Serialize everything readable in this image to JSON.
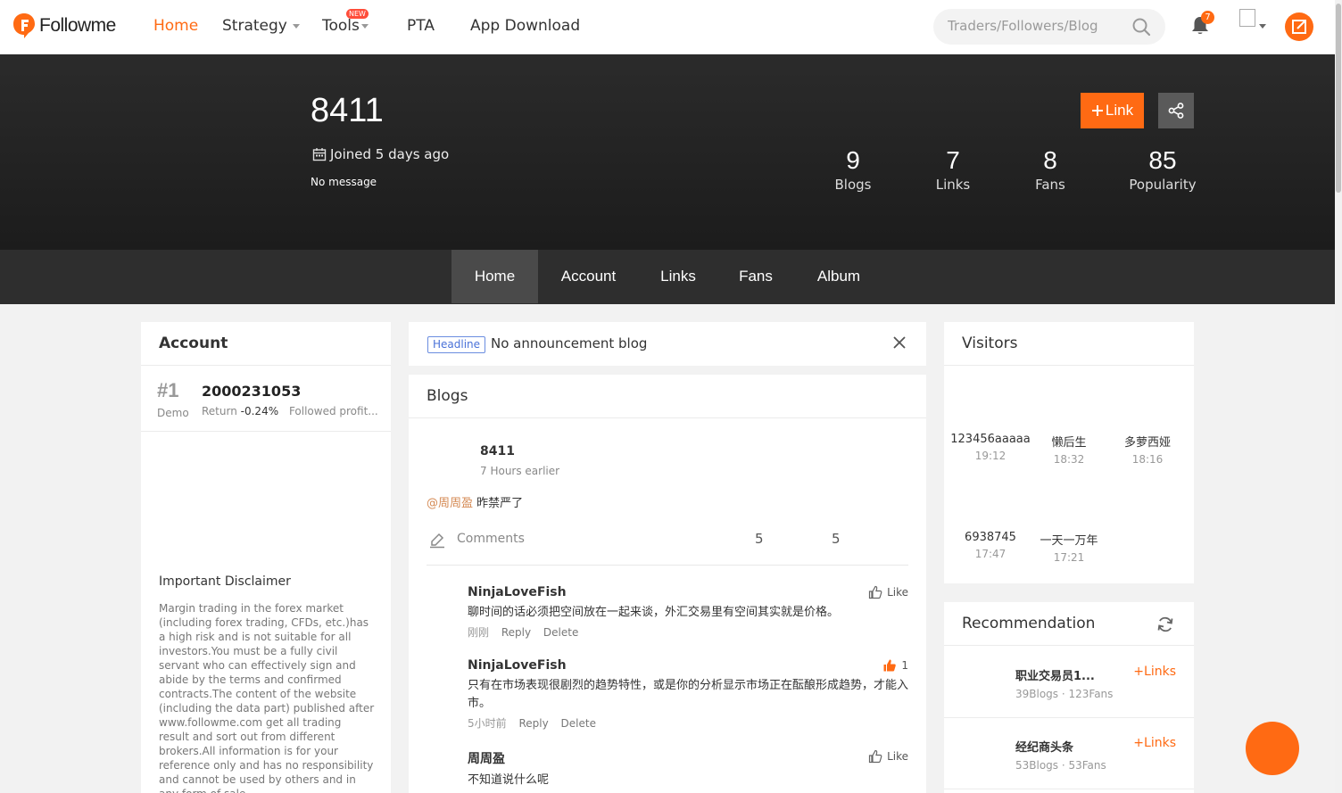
{
  "brand": {
    "name": "Followme",
    "accent": "#ff6a13"
  },
  "nav": {
    "home": "Home",
    "strategy": "Strategy",
    "tools": "Tools",
    "tools_badge": "NEW",
    "pta": "PTA",
    "app": "App Download"
  },
  "search": {
    "placeholder": "Traders/Followers/Blog"
  },
  "notifications": {
    "count": "7"
  },
  "profile": {
    "username": "8411",
    "joined": "Joined 5 days ago",
    "message": "No message",
    "link_button": "Link",
    "stats": [
      {
        "value": "9",
        "label": "Blogs"
      },
      {
        "value": "7",
        "label": "Links"
      },
      {
        "value": "8",
        "label": "Fans"
      },
      {
        "value": "85",
        "label": "Popularity"
      }
    ]
  },
  "tabs": [
    "Home",
    "Account",
    "Links",
    "Fans",
    "Album"
  ],
  "account": {
    "title": "Account",
    "rank": "#1",
    "type": "Demo",
    "number": "2000231053",
    "return_label": "Return",
    "return_value": "-0.24%",
    "followed": "Followed profit...",
    "disclaimer_title": "Important Disclaimer",
    "disclaimer_text": "Margin trading in the forex market (including forex trading, CFDs, etc.)has a high risk and is not suitable for all investors.You must be a fully civil servant who can effectively sign and abide by the terms and confirmed contracts.The content of the website (including the data part) published after www.followme.com get all trading result and sort out from different brokers.All information is for your reference only and has no responsibility and cannot be used by others and in any form of sale."
  },
  "headline": {
    "tag": "Headline",
    "text": "No announcement blog"
  },
  "blogs": {
    "title": "Blogs",
    "post": {
      "author": "8411",
      "time": "7 Hours earlier",
      "mention": "@周周盈",
      "body": " 昨禁严了",
      "comments_label": "Comments",
      "count_a": "5",
      "count_b": "5"
    },
    "comments": [
      {
        "name": "NinjaLoveFish",
        "text": "聊时间的话必须把空间放在一起来谈，外汇交易里有空间其实就是价格。",
        "time": "刚刚",
        "reply": "Reply",
        "delete": "Delete",
        "like": "Like"
      },
      {
        "name": "NinjaLoveFish",
        "text": "只有在市场表现很剧烈的趋势特性，或是你的分析显示市场正在酝酿形成趋势，才能入市。",
        "time": "5小时前",
        "reply": "Reply",
        "delete": "Delete",
        "like": "1"
      },
      {
        "name": "周周盈",
        "text": "不知道说什么呢",
        "like": "Like"
      }
    ]
  },
  "visitors": {
    "title": "Visitors",
    "items": [
      {
        "name": "123456aaaaa",
        "time": "19:12"
      },
      {
        "name": "懒后生",
        "time": "18:32"
      },
      {
        "name": "多萝西娅",
        "time": "18:16"
      },
      {
        "name": "6938745",
        "time": "17:47"
      },
      {
        "name": "一天一万年",
        "time": "17:21"
      }
    ]
  },
  "recommendation": {
    "title": "Recommendation",
    "items": [
      {
        "name": "职业交易员1...",
        "stats": "39Blogs · 123Fans",
        "action": "Links"
      },
      {
        "name": "经纪商头条",
        "stats": "53Blogs · 53Fans",
        "action": "Links"
      }
    ]
  }
}
